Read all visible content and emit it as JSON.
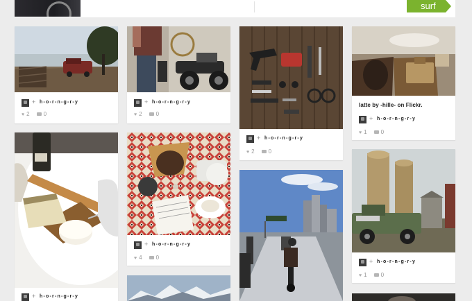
{
  "header": {
    "tag_label": "surf"
  },
  "pins": [
    {
      "id": "p1",
      "user": "h-o-r-n-g-r-y",
      "likes": "2",
      "comments": "0"
    },
    {
      "id": "p2",
      "user": "h-o-r-n-g-r-y",
      "likes": "2",
      "comments": "0"
    },
    {
      "id": "p3",
      "user": "h-o-r-n-g-r-y",
      "likes": "2",
      "comments": "0"
    },
    {
      "id": "p4",
      "caption": "latte by -hille- on Flickr.",
      "user": "h-o-r-n-g-r-y",
      "likes": "1",
      "comments": "0"
    },
    {
      "id": "p5",
      "user": "h-o-r-n-g-r-y"
    },
    {
      "id": "p6",
      "user": "h-o-r-n-g-r-y",
      "likes": "4",
      "comments": "0"
    },
    {
      "id": "p7"
    },
    {
      "id": "p8"
    },
    {
      "id": "p9",
      "user": "h-o-r-n-g-r-y",
      "likes": "1",
      "comments": "0"
    },
    {
      "id": "p10"
    }
  ],
  "icons": {
    "like": "heart-icon",
    "comment": "comment-icon",
    "repin": "plus-icon"
  },
  "colors": {
    "accent": "#7bb32e",
    "background": "#ececec",
    "card": "#ffffff"
  }
}
